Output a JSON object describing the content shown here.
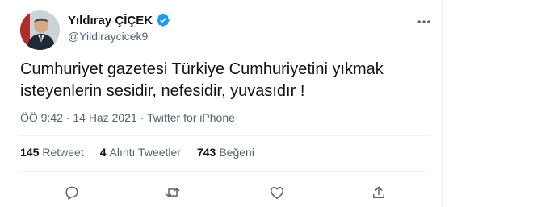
{
  "author": {
    "display_name": "Yıldıray ÇİÇEK",
    "handle": "@Yildiraycicek9",
    "verified": true
  },
  "tweet": {
    "lines": [
      "Cumhuriyet gazetesi Türkiye Cumhuriyetini yıkmak",
      "isteyenlerin sesidir, nefesidir, yuvasıdır !"
    ],
    "timestamp": "ÖÖ 9:42 · 14 Haz 2021 · ",
    "source": "Twitter for iPhone"
  },
  "stats": {
    "retweets_count": "145",
    "retweets_label": "Retweet",
    "quotes_count": "4",
    "quotes_label": "Alıntı Tweetler",
    "likes_count": "743",
    "likes_label": "Beğeni"
  },
  "icons": {
    "more": "more-icon",
    "reply": "reply-icon",
    "retweet": "retweet-icon",
    "like": "like-icon",
    "share": "share-icon",
    "verified": "verified-badge-icon"
  },
  "colors": {
    "verified": "#1d9bf0",
    "secondary_text": "#536471",
    "primary_text": "#0f1419"
  }
}
